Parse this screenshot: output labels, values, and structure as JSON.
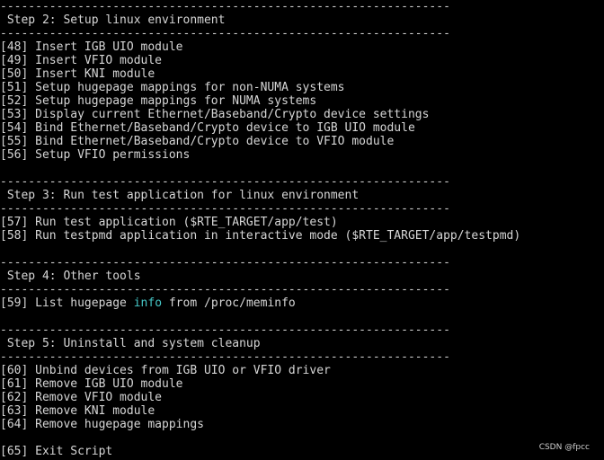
{
  "terminal": {
    "lines": [
      {
        "text": "----------------------------------------------------------------",
        "kind": "separator"
      },
      {
        "text": " Step 2: Setup linux environment",
        "kind": "heading"
      },
      {
        "text": "----------------------------------------------------------------",
        "kind": "separator"
      },
      {
        "text": "[48] Insert IGB UIO module",
        "kind": "option"
      },
      {
        "text": "[49] Insert VFIO module",
        "kind": "option"
      },
      {
        "text": "[50] Insert KNI module",
        "kind": "option"
      },
      {
        "text": "[51] Setup hugepage mappings for non-NUMA systems",
        "kind": "option"
      },
      {
        "text": "[52] Setup hugepage mappings for NUMA systems",
        "kind": "option"
      },
      {
        "text": "[53] Display current Ethernet/Baseband/Crypto device settings",
        "kind": "option"
      },
      {
        "text": "[54] Bind Ethernet/Baseband/Crypto device to IGB UIO module",
        "kind": "option"
      },
      {
        "text": "[55] Bind Ethernet/Baseband/Crypto device to VFIO module",
        "kind": "option"
      },
      {
        "text": "[56] Setup VFIO permissions",
        "kind": "option"
      },
      {
        "text": "",
        "kind": "blank"
      },
      {
        "text": "----------------------------------------------------------------",
        "kind": "separator"
      },
      {
        "text": " Step 3: Run test application for linux environment",
        "kind": "heading"
      },
      {
        "text": "----------------------------------------------------------------",
        "kind": "separator"
      },
      {
        "text": "[57] Run test application ($RTE_TARGET/app/test)",
        "kind": "option"
      },
      {
        "text": "[58] Run testpmd application in interactive mode ($RTE_TARGET/app/testpmd)",
        "kind": "option"
      },
      {
        "text": "",
        "kind": "blank"
      },
      {
        "text": "----------------------------------------------------------------",
        "kind": "separator"
      },
      {
        "text": " Step 4: Other tools",
        "kind": "heading"
      },
      {
        "text": "----------------------------------------------------------------",
        "kind": "separator"
      },
      {
        "pre": "[59] List hugepage ",
        "hl": "info",
        "post": " from /proc/meminfo",
        "kind": "option-hl"
      },
      {
        "text": "",
        "kind": "blank"
      },
      {
        "text": "----------------------------------------------------------------",
        "kind": "separator"
      },
      {
        "text": " Step 5: Uninstall and system cleanup",
        "kind": "heading"
      },
      {
        "text": "----------------------------------------------------------------",
        "kind": "separator"
      },
      {
        "text": "[60] Unbind devices from IGB UIO or VFIO driver",
        "kind": "option"
      },
      {
        "text": "[61] Remove IGB UIO module",
        "kind": "option"
      },
      {
        "text": "[62] Remove VFIO module",
        "kind": "option"
      },
      {
        "text": "[63] Remove KNI module",
        "kind": "option"
      },
      {
        "text": "[64] Remove hugepage mappings",
        "kind": "option"
      },
      {
        "text": "",
        "kind": "blank"
      },
      {
        "text": "[65] Exit Script",
        "kind": "option"
      }
    ],
    "colors": {
      "background": "#000000",
      "text": "#d6d6d6",
      "highlight": "#46c8c8"
    }
  },
  "watermark": {
    "text": "CSDN @fpcc"
  }
}
